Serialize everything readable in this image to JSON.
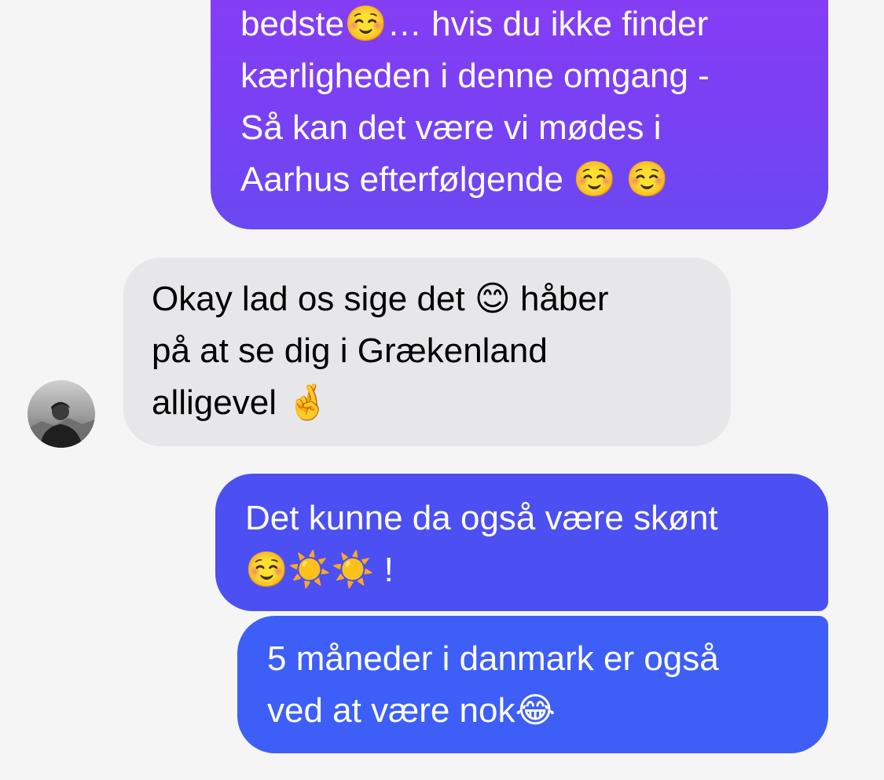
{
  "chat": {
    "messages": [
      {
        "lines": [
          "bedste☺️… hvis du ikke finder",
          "kærligheden i denne omgang -",
          "Så kan det være vi mødes i",
          "Aarhus efterfølgende ☺️ ☺️"
        ]
      },
      {
        "lines": [
          "Okay lad os sige det 😊 håber",
          "på at se dig i Grækenland",
          "alligevel 🤞"
        ]
      },
      {
        "lines": [
          "Det kunne da også være skønt",
          "☺️☀️☀️ !"
        ]
      },
      {
        "lines": [
          "5 måneder i danmark er også",
          "ved at være nok😂"
        ]
      }
    ]
  }
}
